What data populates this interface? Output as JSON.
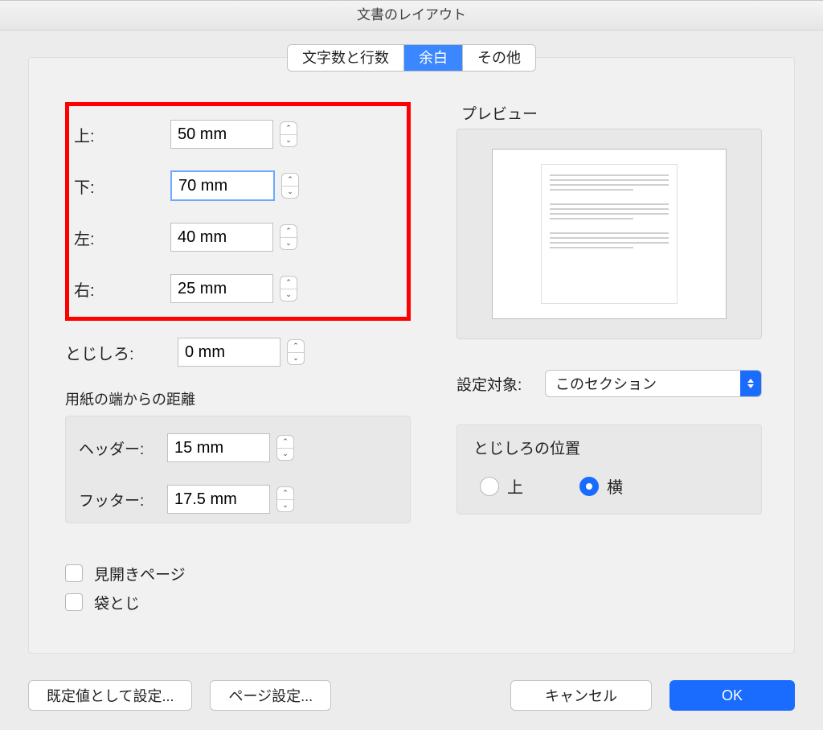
{
  "window": {
    "title": "文書のレイアウト"
  },
  "tabs": {
    "t0": "文字数と行数",
    "t1": "余白",
    "t2": "その他",
    "active": 1
  },
  "margins": {
    "top": {
      "label": "上:",
      "value": "50 mm"
    },
    "bottom": {
      "label": "下:",
      "value": "70 mm",
      "focused": true
    },
    "left": {
      "label": "左:",
      "value": "40 mm"
    },
    "right": {
      "label": "右:",
      "value": "25 mm"
    }
  },
  "gutter": {
    "label": "とじしろ:",
    "value": "0 mm"
  },
  "edge": {
    "group_label": "用紙の端からの距離",
    "header": {
      "label": "ヘッダー:",
      "value": "15 mm"
    },
    "footer": {
      "label": "フッター:",
      "value": "17.5 mm"
    }
  },
  "checks": {
    "facing": {
      "label": "見開きページ",
      "checked": false
    },
    "fold": {
      "label": "袋とじ",
      "checked": false
    }
  },
  "preview": {
    "label": "プレビュー"
  },
  "apply_to": {
    "label": "設定対象:",
    "value": "このセクション"
  },
  "gutter_pos": {
    "label": "とじしろの位置",
    "opt_top": "上",
    "opt_side": "横",
    "selected": "side"
  },
  "footer_btns": {
    "set_default": "既定値として設定...",
    "page_setup": "ページ設定...",
    "cancel": "キャンセル",
    "ok": "OK"
  }
}
